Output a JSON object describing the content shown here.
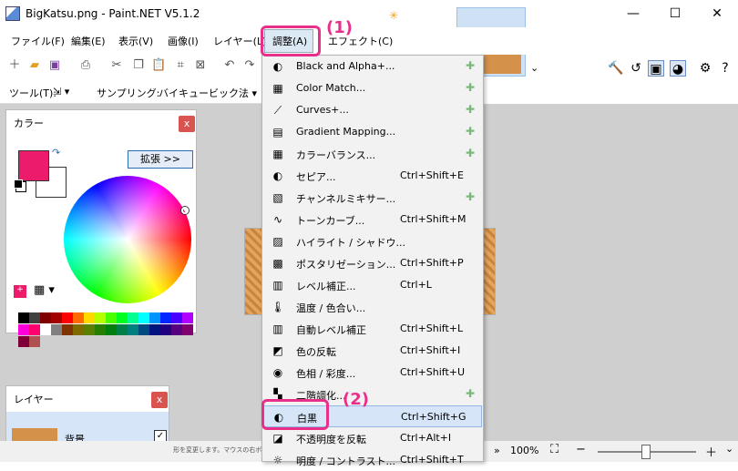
{
  "window": {
    "title": "BigKatsu.png - Paint.NET V5.1.2"
  },
  "menu": [
    "ファイル(F)",
    "編集(E)",
    "表示(V)",
    "画像(I)",
    "レイヤー(L)",
    "調整(A)",
    "エフェクト(C)"
  ],
  "toolbar2": {
    "tool_label": "ツール(T):",
    "sampling_label": "サンプリング:",
    "sampling_value": "バイキュービック法"
  },
  "color_panel": {
    "title": "カラー",
    "expand_label": "拡張 >>",
    "primary": "#ed1b6b",
    "secondary": "#ffffff"
  },
  "palette": [
    "#000000",
    "#404040",
    "#7f0000",
    "#a30000",
    "#ff0000",
    "#ff6a00",
    "#ffd800",
    "#b6ff00",
    "#4cff00",
    "#00ff21",
    "#00ff90",
    "#00ffff",
    "#0094ff",
    "#0026ff",
    "#4800ff",
    "#b200ff",
    "#ff00dc",
    "#ff006e"
  ],
  "layers_panel": {
    "title": "レイヤー",
    "layer_name": "背景"
  },
  "adjust_menu": [
    {
      "label": "Black and Alpha+...",
      "shortcut": "",
      "plugin": true,
      "icon": "black-alpha"
    },
    {
      "label": "Color Match...",
      "shortcut": "",
      "plugin": true,
      "icon": "color-match"
    },
    {
      "label": "Curves+...",
      "shortcut": "",
      "plugin": true,
      "icon": "curves-plus"
    },
    {
      "label": "Gradient Mapping...",
      "shortcut": "",
      "plugin": true,
      "icon": "gradient-mapping"
    },
    {
      "label": "カラーバランス...",
      "shortcut": "",
      "plugin": true,
      "icon": "color-balance"
    },
    {
      "label": "セピア...",
      "shortcut": "Ctrl+Shift+E",
      "plugin": false,
      "icon": "sepia"
    },
    {
      "label": "チャンネルミキサー...",
      "shortcut": "",
      "plugin": true,
      "icon": "channel-mixer"
    },
    {
      "label": "トーンカーブ...",
      "shortcut": "Ctrl+Shift+M",
      "plugin": false,
      "icon": "tone-curve"
    },
    {
      "label": "ハイライト / シャドウ...",
      "shortcut": "",
      "plugin": false,
      "icon": "highlight-shadow"
    },
    {
      "label": "ポスタリゼーション...",
      "shortcut": "Ctrl+Shift+P",
      "plugin": false,
      "icon": "posterize"
    },
    {
      "label": "レベル補正...",
      "shortcut": "Ctrl+L",
      "plugin": false,
      "icon": "levels"
    },
    {
      "label": "温度 / 色合い...",
      "shortcut": "",
      "plugin": false,
      "icon": "temperature"
    },
    {
      "label": "自動レベル補正",
      "shortcut": "Ctrl+Shift+L",
      "plugin": false,
      "icon": "auto-level"
    },
    {
      "label": "色の反転",
      "shortcut": "Ctrl+Shift+I",
      "plugin": false,
      "icon": "invert"
    },
    {
      "label": "色相 / 彩度...",
      "shortcut": "Ctrl+Shift+U",
      "plugin": false,
      "icon": "hue-saturation"
    },
    {
      "label": "二階調化...",
      "shortcut": "",
      "plugin": true,
      "icon": "threshold"
    },
    {
      "label": "白黒",
      "shortcut": "Ctrl+Shift+G",
      "plugin": false,
      "icon": "black-white"
    },
    {
      "label": "不透明度を反転",
      "shortcut": "Ctrl+Alt+I",
      "plugin": false,
      "icon": "invert-alpha"
    },
    {
      "label": "明度 / コントラスト...",
      "shortcut": "Ctrl+Shift+T",
      "plugin": false,
      "icon": "brightness-contrast"
    }
  ],
  "annotations": {
    "label1": "(1)",
    "label2": "(2)"
  },
  "status": {
    "hint": "形を変更します。マウスの右ボタンで...",
    "zoom": "100%"
  }
}
